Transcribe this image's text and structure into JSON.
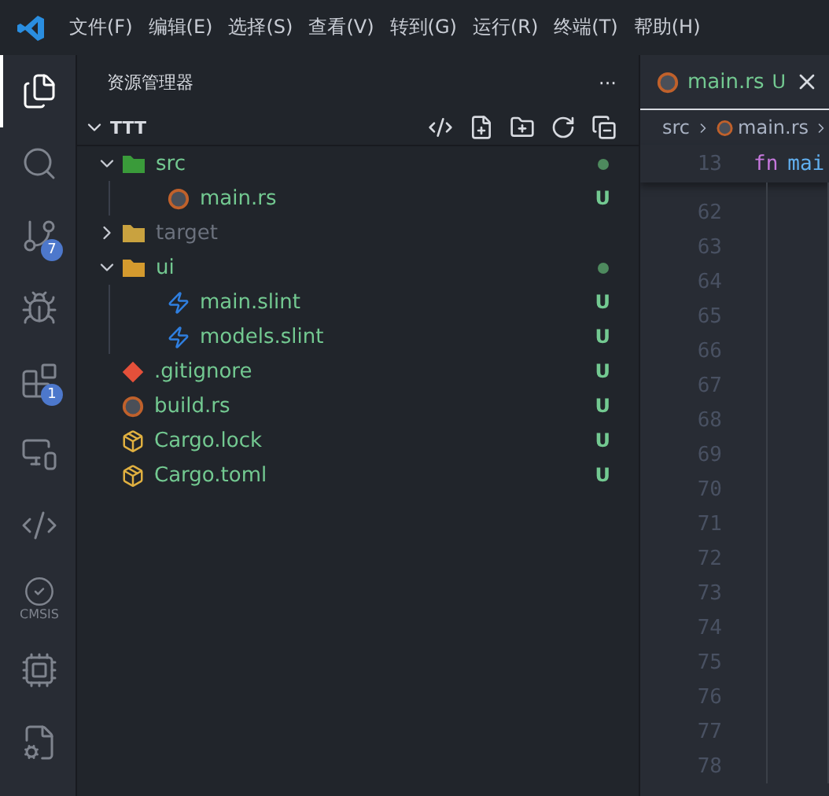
{
  "menu": [
    "文件(F)",
    "编辑(E)",
    "选择(S)",
    "查看(V)",
    "转到(G)",
    "运行(R)",
    "终端(T)",
    "帮助(H)"
  ],
  "activity_bar": [
    {
      "kind": "files",
      "selected": true
    },
    {
      "kind": "search",
      "selected": false
    },
    {
      "kind": "scm",
      "selected": false,
      "badge": "7"
    },
    {
      "kind": "debug",
      "selected": false
    },
    {
      "kind": "extensions",
      "selected": false,
      "badge": "1"
    },
    {
      "kind": "remote",
      "selected": false
    },
    {
      "kind": "code",
      "selected": false
    },
    {
      "kind": "cmsis",
      "selected": false,
      "label": "CMSIS"
    },
    {
      "kind": "chip",
      "selected": false
    },
    {
      "kind": "filegear",
      "selected": false
    }
  ],
  "sidebar": {
    "title": "资源管理器",
    "more": "···",
    "section": "TTT",
    "expanded": true,
    "tree": [
      {
        "name": "src",
        "kind": "srcfolder",
        "expanded": true,
        "ignored": false,
        "dot": true,
        "children": [
          {
            "name": "main.rs",
            "kind": "rust",
            "ignored": false,
            "badge": "U"
          }
        ]
      },
      {
        "name": "target",
        "kind": "targetfolder",
        "expanded": false,
        "ignored": true,
        "dot": false
      },
      {
        "name": "ui",
        "kind": "uifolder",
        "expanded": true,
        "ignored": false,
        "dot": true,
        "children": [
          {
            "name": "main.slint",
            "kind": "slint",
            "ignored": false,
            "badge": "U"
          },
          {
            "name": "models.slint",
            "kind": "slint",
            "ignored": false,
            "badge": "U"
          }
        ]
      },
      {
        "name": ".gitignore",
        "kind": "git",
        "ignored": false,
        "badge": "U"
      },
      {
        "name": "build.rs",
        "kind": "rust",
        "ignored": false,
        "badge": "U"
      },
      {
        "name": "Cargo.lock",
        "kind": "cargo",
        "ignored": false,
        "badge": "U"
      },
      {
        "name": "Cargo.toml",
        "kind": "cargo",
        "ignored": false,
        "badge": "U"
      }
    ]
  },
  "editor": {
    "tabs": [
      {
        "label": "main.rs",
        "badge": "U",
        "selected": true
      }
    ],
    "breadcrumb": [
      "src",
      "main.rs"
    ],
    "sticky": {
      "line": "13",
      "tokens": [
        {
          "text": "fn",
          "kind": "keyword"
        },
        {
          "text": "mai",
          "kind": "function"
        }
      ]
    },
    "line_numbers": [
      "62",
      "63",
      "64",
      "65",
      "66",
      "67",
      "68",
      "69",
      "70",
      "71",
      "72",
      "73",
      "74",
      "75",
      "76",
      "77",
      "78"
    ]
  }
}
